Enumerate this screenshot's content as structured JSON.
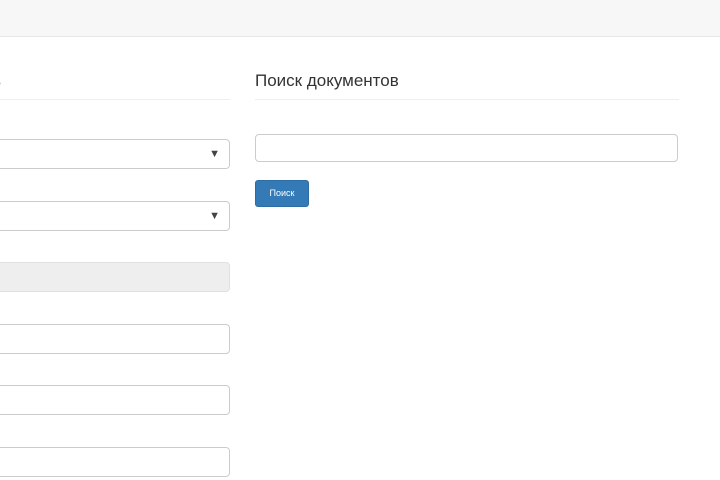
{
  "left_panel": {
    "title_fragment": "в",
    "dropdown_1_caret": "▼",
    "dropdown_2_caret": "▼"
  },
  "document_search": {
    "title": "Поиск документов",
    "query_value": "",
    "query_placeholder": "",
    "search_button_label": "Поиск"
  },
  "colors": {
    "primary_button": "#337ab7",
    "input_border": "#cccccc",
    "disabled_field": "#eeeeee",
    "topbar": "#f7f7f7"
  }
}
